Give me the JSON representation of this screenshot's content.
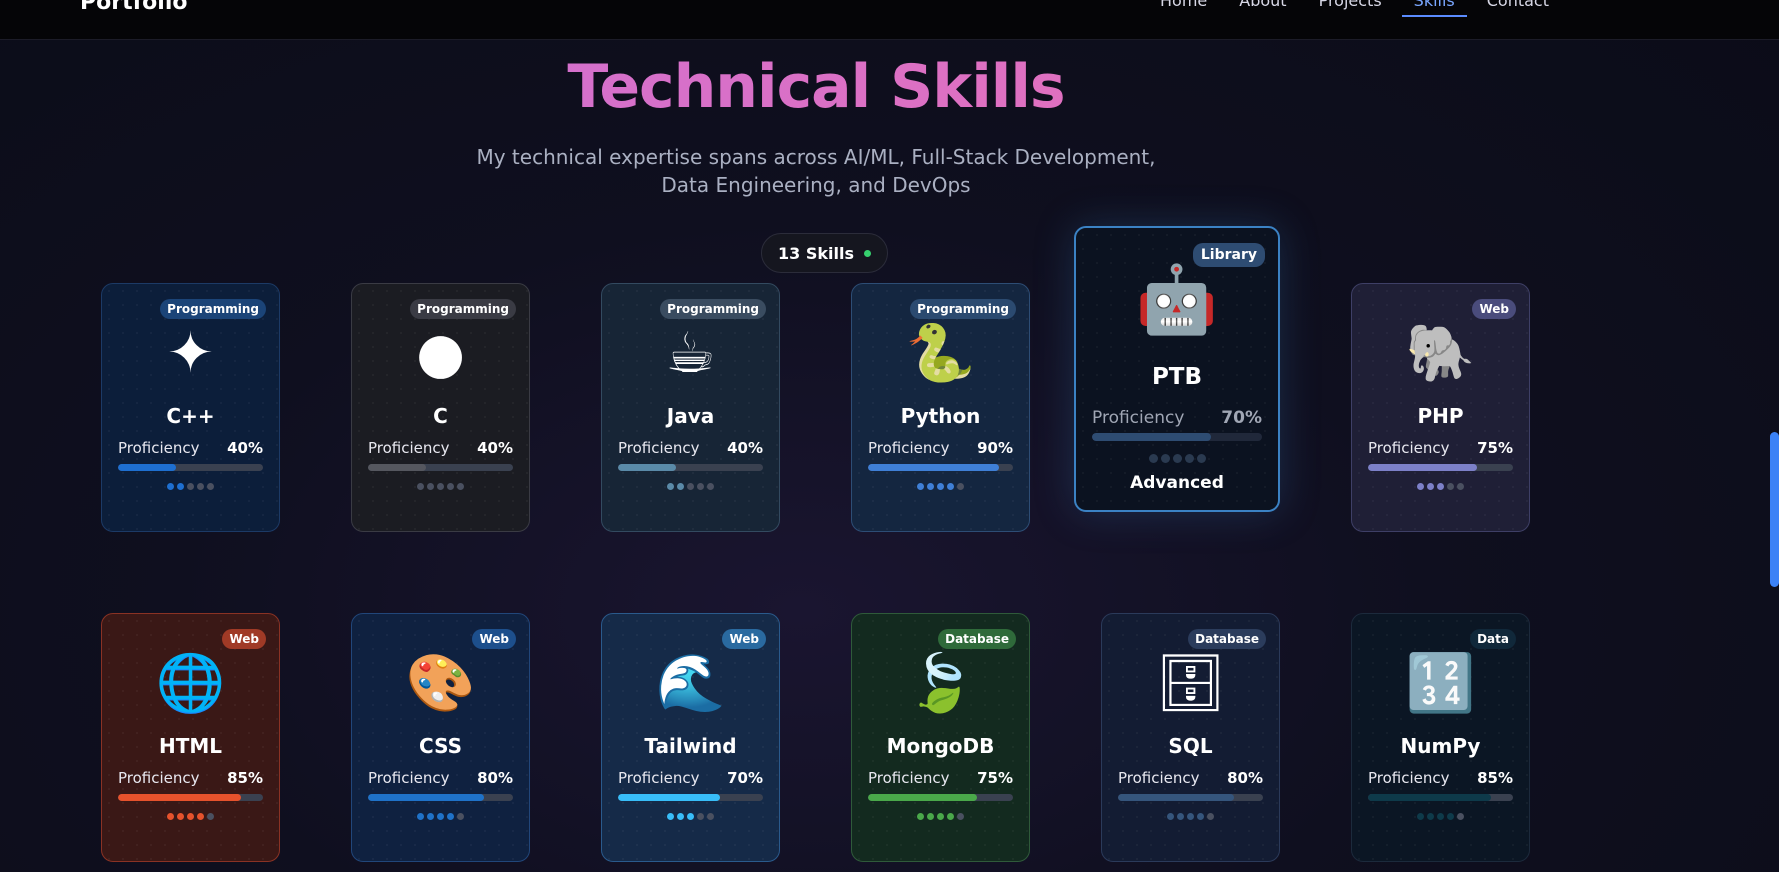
{
  "brand": "Portfolio",
  "nav": [
    {
      "label": "Home",
      "active": false
    },
    {
      "label": "About",
      "active": false
    },
    {
      "label": "Projects",
      "active": false
    },
    {
      "label": "Skills",
      "active": true
    },
    {
      "label": "Contact",
      "active": false
    }
  ],
  "title": "Technical Skills",
  "subtitle": "My technical expertise spans across AI/ML, Full-Stack Development, Data Engineering, and DevOps",
  "skill_count_label": "13 Skills",
  "proficiency_label": "Proficiency",
  "skills": [
    {
      "name": "C++",
      "category": "Programming",
      "icon": "✦",
      "icon_name": "cpp-diamond-icon",
      "percent": "40%",
      "value": 40,
      "dots_on": 2,
      "accent": "#1e6fd0",
      "bg": "#0c1e3a",
      "border": "#1c3a66",
      "badge_bg": "#1b4478"
    },
    {
      "name": "C",
      "category": "Programming",
      "icon": "●",
      "icon_name": "c-sphere-icon",
      "percent": "40%",
      "value": 40,
      "dots_on": 0,
      "accent": "#55575f",
      "bg": "#1b1c22",
      "border": "#3a3b44",
      "badge_bg": "#3a3b44"
    },
    {
      "name": "Java",
      "category": "Programming",
      "icon": "☕",
      "icon_name": "java-mug-icon",
      "percent": "40%",
      "value": 40,
      "dots_on": 2,
      "accent": "#5a8aa8",
      "bg": "#172536",
      "border": "#334a60",
      "badge_bg": "#3a4c60"
    },
    {
      "name": "Python",
      "category": "Programming",
      "icon": "🐍",
      "icon_name": "python-snake-icon",
      "percent": "90%",
      "value": 90,
      "dots_on": 4,
      "accent": "#3f7fd6",
      "bg": "#142640",
      "border": "#2d4d75",
      "badge_bg": "#2b4a70"
    },
    {
      "name": "PTB",
      "category": "Library",
      "icon": "🤖",
      "icon_name": "ptb-robot-icon",
      "percent": "70%",
      "value": 70,
      "dots_on": 0,
      "accent": "#2e4c72",
      "bg": "#0b1220",
      "border": "#3b82c4",
      "badge_bg": "#2e4c72",
      "level": "Advanced",
      "featured": true
    },
    {
      "name": "PHP",
      "category": "Web",
      "icon": "🐘",
      "icon_name": "php-elephant-icon",
      "percent": "75%",
      "value": 75,
      "dots_on": 3,
      "accent": "#7c80c8",
      "bg": "#1f1f36",
      "border": "#3e3f66",
      "badge_bg": "#4a4c7c"
    },
    {
      "name": "HTML",
      "category": "Web",
      "icon": "🌐",
      "icon_name": "html-globe-icon",
      "percent": "85%",
      "value": 85,
      "dots_on": 4,
      "accent": "#e6522c",
      "bg": "#3a1816",
      "border": "#8a3224",
      "badge_bg": "#a03a26"
    },
    {
      "name": "CSS",
      "category": "Web",
      "icon": "🎨",
      "icon_name": "css-palette-icon",
      "percent": "80%",
      "value": 80,
      "dots_on": 4,
      "accent": "#1f72c8",
      "bg": "#0f2140",
      "border": "#21467a",
      "badge_bg": "#1d4f8c"
    },
    {
      "name": "Tailwind",
      "category": "Web",
      "icon": "🌊",
      "icon_name": "tailwind-wave-icon",
      "percent": "70%",
      "value": 70,
      "dots_on": 3,
      "accent": "#38bdf8",
      "bg": "#152a48",
      "border": "#2a5a8c",
      "badge_bg": "#2a6aa0"
    },
    {
      "name": "MongoDB",
      "category": "Database",
      "icon": "🍃",
      "icon_name": "mongodb-leaf-icon",
      "percent": "75%",
      "value": 75,
      "dots_on": 4,
      "accent": "#4aa84a",
      "bg": "#132a1f",
      "border": "#2f5a3a",
      "badge_bg": "#2f6a3a"
    },
    {
      "name": "SQL",
      "category": "Database",
      "icon": "🗄",
      "icon_name": "sql-cabinet-icon",
      "percent": "80%",
      "value": 80,
      "dots_on": 4,
      "accent": "#35557c",
      "bg": "#131c33",
      "border": "#2b3a5a",
      "badge_bg": "#2b3c5c"
    },
    {
      "name": "NumPy",
      "category": "Data",
      "icon": "🔢",
      "icon_name": "numpy-numbers-icon",
      "percent": "85%",
      "value": 85,
      "dots_on": 4,
      "accent": "#0e3a4a",
      "bg": "#0b1624",
      "border": "#1c2a3c",
      "badge_bg": "#10283a"
    }
  ]
}
